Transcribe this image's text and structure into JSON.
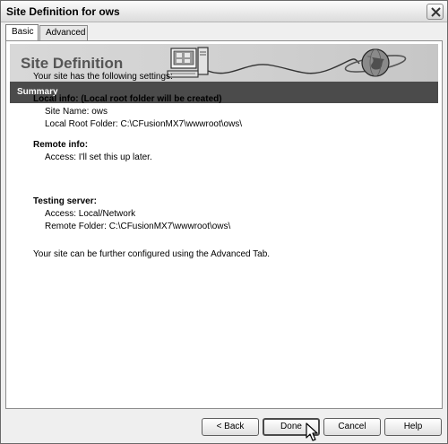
{
  "window": {
    "title": "Site Definition for ows"
  },
  "tabs": [
    {
      "label": "Basic"
    },
    {
      "label": "Advanced"
    }
  ],
  "banner": {
    "title": "Site Definition"
  },
  "section": {
    "title": "Summary"
  },
  "summary": {
    "intro": "Your site has the following settings:",
    "local_heading": "Local info: (Local root folder will be created)",
    "site_name": "Site Name: ows",
    "local_root": "Local Root Folder: C:\\CFusionMX7\\wwwroot\\ows\\",
    "remote_heading": "Remote info:",
    "remote_access": "Access: I'll set this up later.",
    "testing_heading": "Testing server:",
    "testing_access": "Access: Local/Network",
    "remote_folder": "Remote Folder: C:\\CFusionMX7\\wwwroot\\ows\\",
    "footer_note": "Your site can be further configured using the Advanced Tab."
  },
  "buttons": {
    "back": "< Back",
    "done": "Done",
    "cancel": "Cancel",
    "help": "Help"
  },
  "icons": {
    "close": "close-icon",
    "computer": "computer-icon",
    "globe": "globe-icon",
    "cursor": "mouse-cursor-icon"
  }
}
